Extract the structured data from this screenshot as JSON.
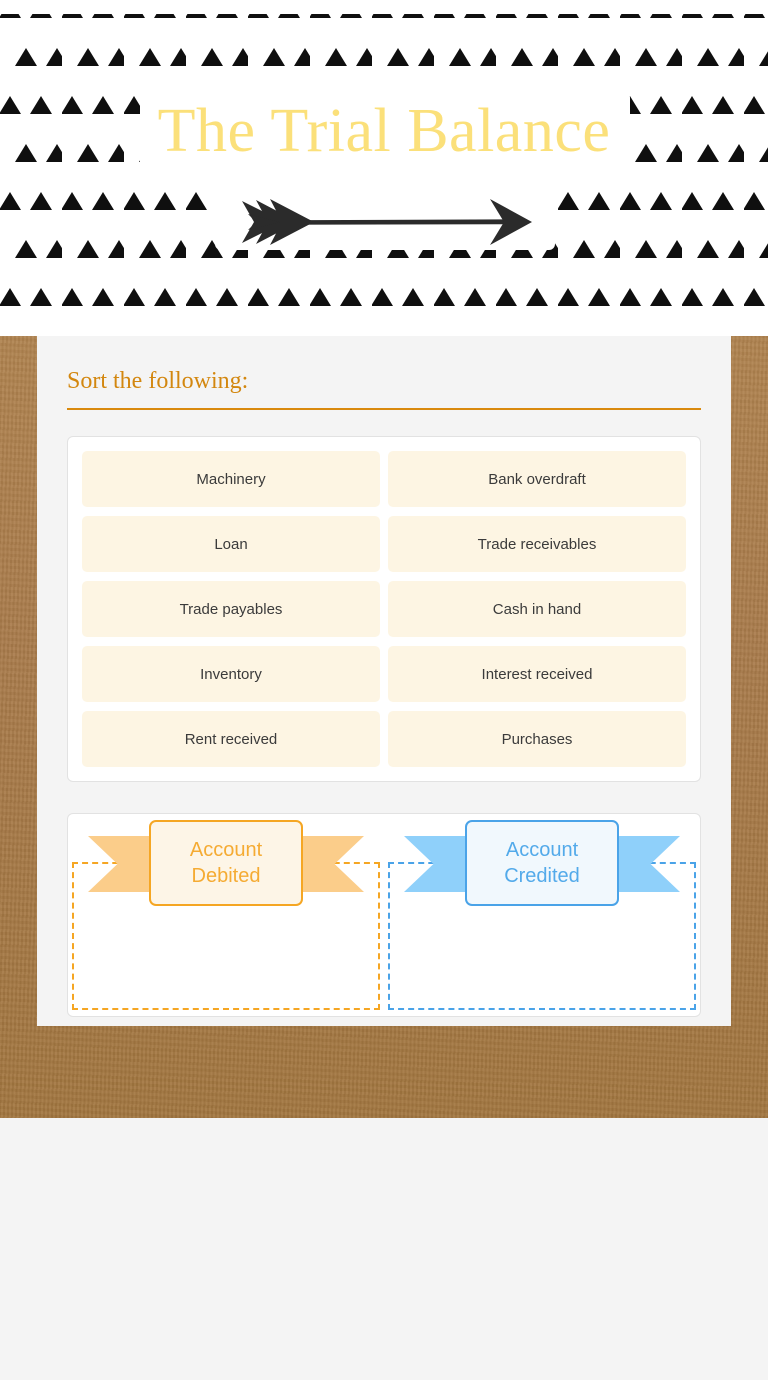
{
  "header": {
    "title": "The Trial Balance",
    "title_color": "#fbe07a",
    "pattern": "triangle-pattern",
    "arrow_icon": "arrow-right-icon",
    "background_color": "#ffffff"
  },
  "background": {
    "texture": "kraft-paper",
    "color": "#a97b4b"
  },
  "card": {
    "prompt": "Sort the following:",
    "prompt_color": "#d3870f",
    "background_color": "#f4f4f4"
  },
  "tiles": {
    "tile_background": "#fdf5e3",
    "tile_text_color": "#3b3b3b",
    "items": [
      {
        "label": "Machinery"
      },
      {
        "label": "Bank overdraft"
      },
      {
        "label": "Loan"
      },
      {
        "label": "Trade receivables"
      },
      {
        "label": "Trade payables"
      },
      {
        "label": "Cash in hand"
      },
      {
        "label": "Inventory"
      },
      {
        "label": "Interest received"
      },
      {
        "label": "Rent received"
      },
      {
        "label": "Purchases"
      }
    ]
  },
  "dropzones": [
    {
      "id": "account-debited",
      "line1": "Account",
      "line2": "Debited",
      "accent_color": "#f5a623",
      "wing_color": "#fbcd8a",
      "body_background": "#fdf5e7",
      "items": []
    },
    {
      "id": "account-credited",
      "line1": "Account",
      "line2": "Credited",
      "accent_color": "#4aa3e8",
      "wing_color": "#8fd0fa",
      "body_background": "#f1f8fd",
      "items": []
    }
  ]
}
